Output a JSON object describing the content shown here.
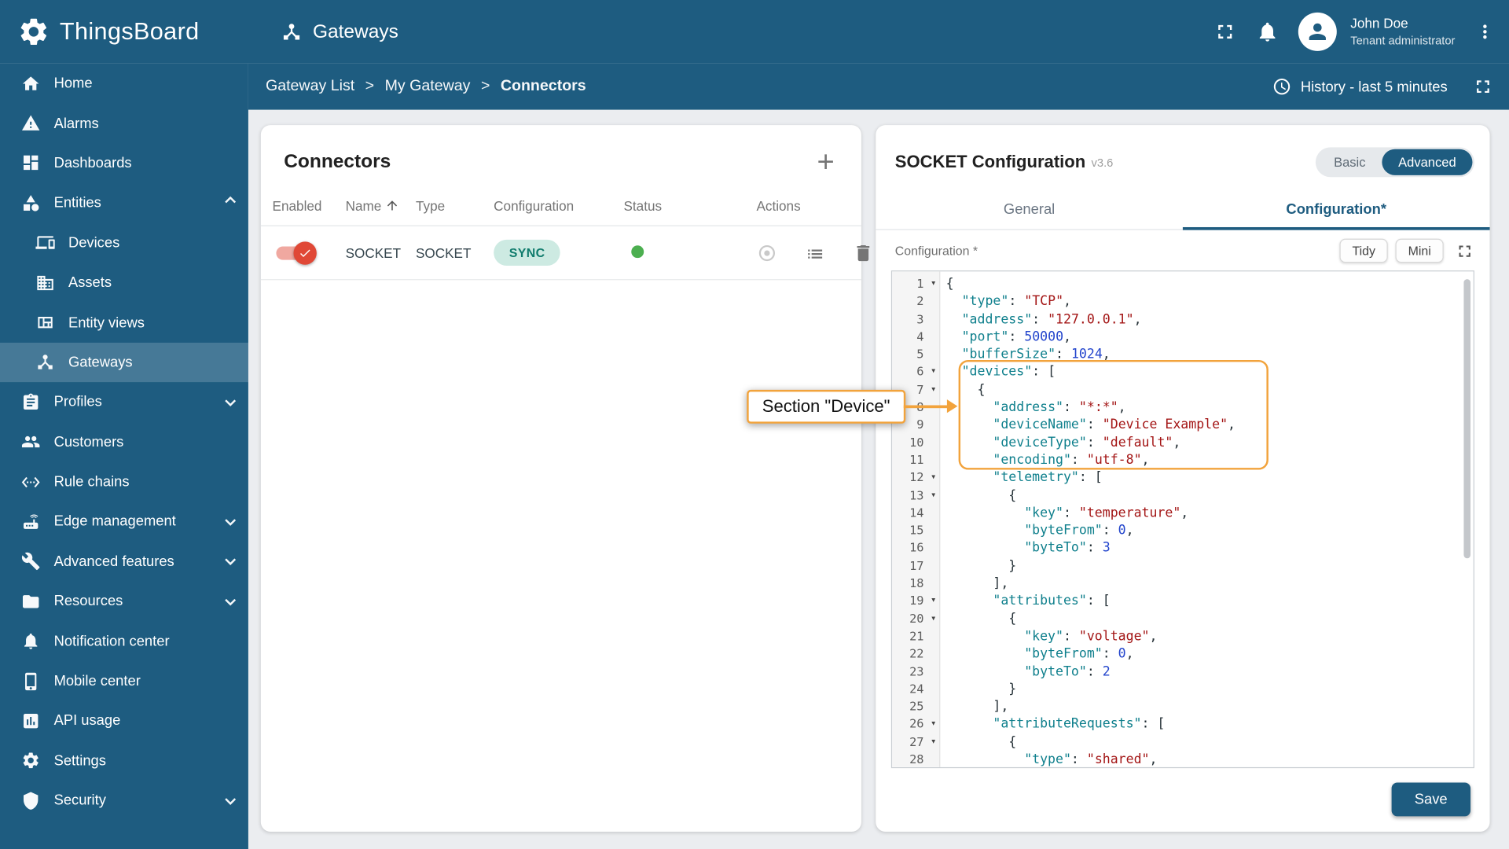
{
  "colors": {
    "primary": "#1e5c80",
    "accent_orange": "#f2a33c",
    "status_green": "#4caf50",
    "toggle_red": "#e04836",
    "chip_bg": "#cdeae2",
    "chip_text": "#0f7b6c",
    "code_key": "#0e7f8c",
    "code_string": "#a31515",
    "code_number": "#2244cc"
  },
  "app": {
    "brand": "ThingsBoard",
    "page_title": "Gateways",
    "user": {
      "name": "John Doe",
      "role": "Tenant administrator"
    },
    "breadcrumb": [
      "Gateway List",
      "My Gateway",
      "Connectors"
    ],
    "history_label": "History - last 5 minutes"
  },
  "sidebar": {
    "items": [
      {
        "label": "Home",
        "icon": "home"
      },
      {
        "label": "Alarms",
        "icon": "alarms"
      },
      {
        "label": "Dashboards",
        "icon": "dashboards"
      },
      {
        "label": "Entities",
        "icon": "entities",
        "expand": "up"
      },
      {
        "label": "Devices",
        "icon": "devices",
        "child": true
      },
      {
        "label": "Assets",
        "icon": "assets",
        "child": true
      },
      {
        "label": "Entity views",
        "icon": "entity-views",
        "child": true
      },
      {
        "label": "Gateways",
        "icon": "gateways",
        "child": true,
        "selected": true
      },
      {
        "label": "Profiles",
        "icon": "profiles",
        "expand": "down"
      },
      {
        "label": "Customers",
        "icon": "customers"
      },
      {
        "label": "Rule chains",
        "icon": "rule-chains"
      },
      {
        "label": "Edge management",
        "icon": "edge-management",
        "expand": "down"
      },
      {
        "label": "Advanced features",
        "icon": "advanced-features",
        "expand": "down"
      },
      {
        "label": "Resources",
        "icon": "resources",
        "expand": "down"
      },
      {
        "label": "Notification center",
        "icon": "notification-center"
      },
      {
        "label": "Mobile center",
        "icon": "mobile-center"
      },
      {
        "label": "API usage",
        "icon": "api-usage"
      },
      {
        "label": "Settings",
        "icon": "settings"
      },
      {
        "label": "Security",
        "icon": "security",
        "expand": "down"
      }
    ]
  },
  "connectors_panel": {
    "title": "Connectors",
    "columns": [
      "Enabled",
      "Name",
      "Type",
      "Configuration",
      "Status",
      "Actions"
    ],
    "sorted_column": "Name",
    "rows": [
      {
        "enabled": true,
        "name": "SOCKET",
        "type": "SOCKET",
        "configuration": "SYNC",
        "status": "active"
      }
    ]
  },
  "config_panel": {
    "title": "SOCKET Configuration",
    "version": "v3.6",
    "modes": {
      "basic": "Basic",
      "advanced": "Advanced",
      "selected": "Advanced"
    },
    "tabs": [
      "General",
      "Configuration*"
    ],
    "active_tab": "Configuration*",
    "field_label": "Configuration *",
    "editor_buttons": [
      "Tidy",
      "Mini"
    ],
    "save_label": "Save",
    "annotation": "Section \"Device\"",
    "code_lines": [
      "{",
      "  \"type\": \"TCP\",",
      "  \"address\": \"127.0.0.1\",",
      "  \"port\": 50000,",
      "  \"bufferSize\": 1024,",
      "  \"devices\": [",
      "    {",
      "      \"address\": \"*:*\",",
      "      \"deviceName\": \"Device Example\",",
      "      \"deviceType\": \"default\",",
      "      \"encoding\": \"utf-8\",",
      "      \"telemetry\": [",
      "        {",
      "          \"key\": \"temperature\",",
      "          \"byteFrom\": 0,",
      "          \"byteTo\": 3",
      "        }",
      "      ],",
      "      \"attributes\": [",
      "        {",
      "          \"key\": \"voltage\",",
      "          \"byteFrom\": 0,",
      "          \"byteTo\": 2",
      "        }",
      "      ],",
      "      \"attributeRequests\": [",
      "        {",
      "          \"type\": \"shared\","
    ]
  }
}
